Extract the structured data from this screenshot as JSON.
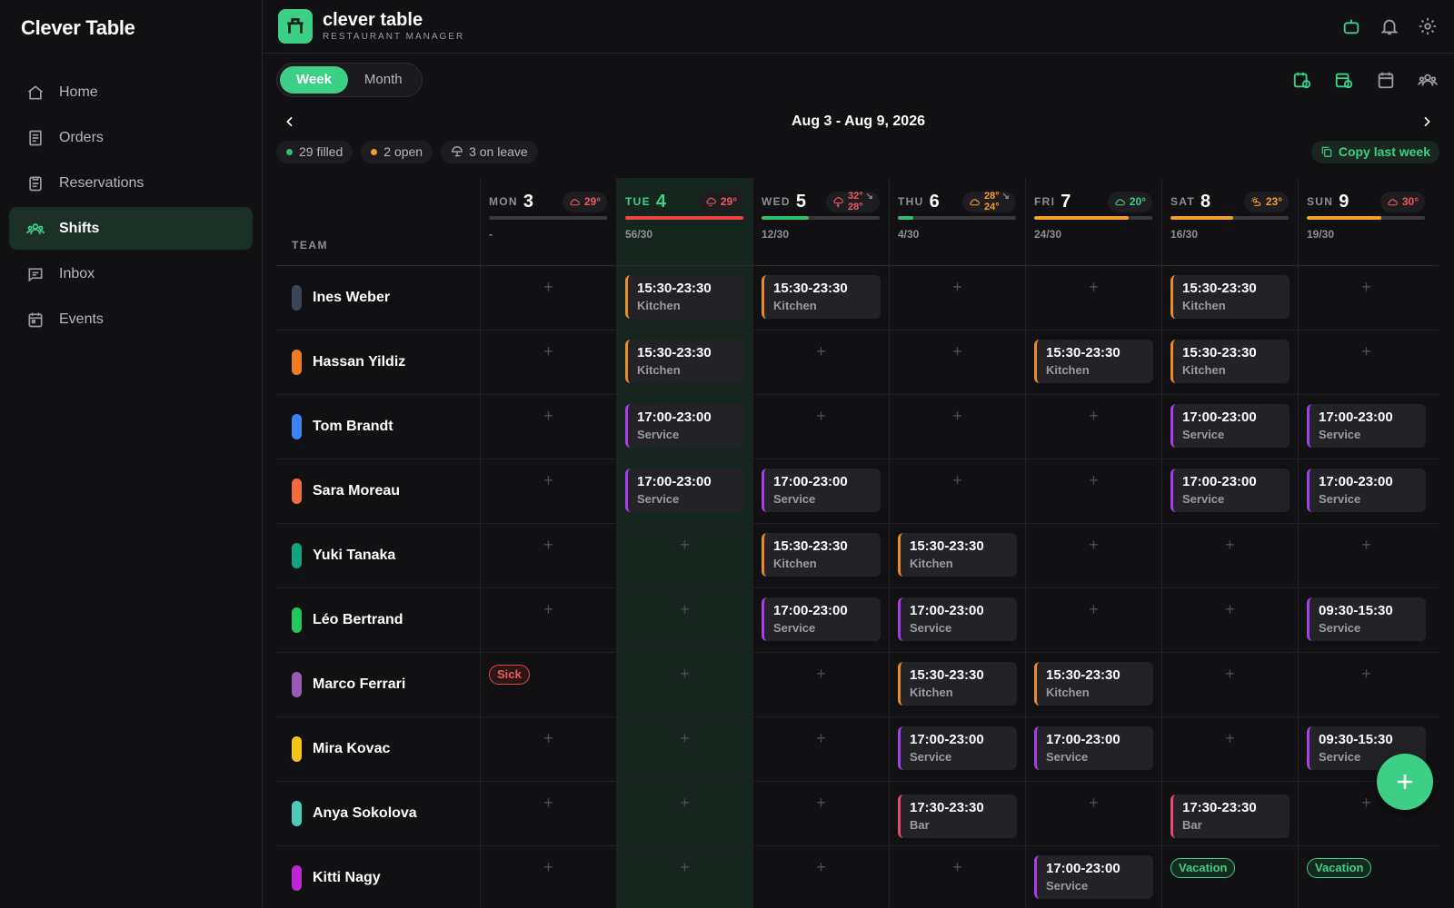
{
  "brand": "Clever Table",
  "nav": [
    {
      "label": "Home",
      "icon": "home-icon",
      "active": false
    },
    {
      "label": "Orders",
      "icon": "orders-icon",
      "active": false
    },
    {
      "label": "Reservations",
      "icon": "clipboard-icon",
      "active": false
    },
    {
      "label": "Shifts",
      "icon": "team-icon",
      "active": true
    },
    {
      "label": "Inbox",
      "icon": "inbox-icon",
      "active": false
    },
    {
      "label": "Events",
      "icon": "calendar-icon",
      "active": false
    }
  ],
  "header": {
    "app_name": "clever table",
    "app_sub": "RESTAURANT MANAGER"
  },
  "view_toggle": {
    "week": "Week",
    "month": "Month",
    "selected": "Week"
  },
  "date_range": "Aug 3 - Aug 9, 2026",
  "stats": {
    "filled": "29 filled",
    "open": "2 open",
    "leave": "3 on leave",
    "copy_label": "Copy last week"
  },
  "team_header": "TEAM",
  "days": [
    {
      "name": "MON",
      "num": "3",
      "temp": "29°",
      "temp2": "",
      "trend": "",
      "weather": "cloud",
      "wx_color": "#ef5a5a",
      "coverage": "-",
      "fill": 0,
      "bar_color": "#38383e",
      "today": false
    },
    {
      "name": "TUE",
      "num": "4",
      "temp": "29°",
      "temp2": "",
      "trend": "",
      "weather": "rain",
      "wx_color": "#ef5a5a",
      "coverage": "56/30",
      "fill": 1,
      "bar_color": "#ef4444",
      "today": true
    },
    {
      "name": "WED",
      "num": "5",
      "temp": "32°",
      "temp2": "28°",
      "trend": "↘",
      "weather": "storm",
      "wx_color": "#ef5a5a",
      "coverage": "12/30",
      "fill": 0.4,
      "bar_color": "#2fbf6e",
      "today": false
    },
    {
      "name": "THU",
      "num": "6",
      "temp": "28°",
      "temp2": "24°",
      "trend": "↘",
      "weather": "cloud",
      "wx_color": "#f59e2a",
      "coverage": "4/30",
      "fill": 0.13,
      "bar_color": "#2fbf6e",
      "today": false
    },
    {
      "name": "FRI",
      "num": "7",
      "temp": "20°",
      "temp2": "",
      "trend": "",
      "weather": "cloud",
      "wx_color": "#3ecf86",
      "coverage": "24/30",
      "fill": 0.8,
      "bar_color": "#f59e2a",
      "today": false
    },
    {
      "name": "SAT",
      "num": "8",
      "temp": "23°",
      "temp2": "",
      "trend": "",
      "weather": "sun-cloud",
      "wx_color": "#f59e2a",
      "coverage": "16/30",
      "fill": 0.53,
      "bar_color": "#f59e2a",
      "today": false
    },
    {
      "name": "SUN",
      "num": "9",
      "temp": "30°",
      "temp2": "",
      "trend": "",
      "weather": "cloud",
      "wx_color": "#ef5a5a",
      "coverage": "19/30",
      "fill": 0.63,
      "bar_color": "#f59e2a",
      "today": false
    }
  ],
  "team": [
    {
      "name": "Ines Weber",
      "color": "#3a4658",
      "cells": [
        null,
        {
          "time": "15:30-23:30",
          "role": "Kitchen"
        },
        {
          "time": "15:30-23:30",
          "role": "Kitchen"
        },
        null,
        null,
        {
          "time": "15:30-23:30",
          "role": "Kitchen"
        },
        null
      ]
    },
    {
      "name": "Hassan Yildiz",
      "color": "#f07c22",
      "cells": [
        null,
        {
          "time": "15:30-23:30",
          "role": "Kitchen"
        },
        null,
        null,
        {
          "time": "15:30-23:30",
          "role": "Kitchen"
        },
        {
          "time": "15:30-23:30",
          "role": "Kitchen"
        },
        null
      ]
    },
    {
      "name": "Tom Brandt",
      "color": "#3b82f6",
      "cells": [
        null,
        {
          "time": "17:00-23:00",
          "role": "Service"
        },
        null,
        null,
        null,
        {
          "time": "17:00-23:00",
          "role": "Service"
        },
        {
          "time": "17:00-23:00",
          "role": "Service"
        }
      ]
    },
    {
      "name": "Sara Moreau",
      "color": "#f26b3a",
      "cells": [
        null,
        {
          "time": "17:00-23:00",
          "role": "Service"
        },
        {
          "time": "17:00-23:00",
          "role": "Service"
        },
        null,
        null,
        {
          "time": "17:00-23:00",
          "role": "Service"
        },
        {
          "time": "17:00-23:00",
          "role": "Service"
        }
      ]
    },
    {
      "name": "Yuki Tanaka",
      "color": "#14a37f",
      "cells": [
        null,
        null,
        {
          "time": "15:30-23:30",
          "role": "Kitchen"
        },
        {
          "time": "15:30-23:30",
          "role": "Kitchen"
        },
        null,
        null,
        null
      ]
    },
    {
      "name": "Léo Bertrand",
      "color": "#22c55e",
      "cells": [
        null,
        null,
        {
          "time": "17:00-23:00",
          "role": "Service"
        },
        {
          "time": "17:00-23:00",
          "role": "Service"
        },
        null,
        null,
        {
          "time": "09:30-15:30",
          "role": "Service"
        }
      ]
    },
    {
      "name": "Marco Ferrari",
      "color": "#9b59b6",
      "cells": [
        {
          "tag": "Sick"
        },
        null,
        null,
        {
          "time": "15:30-23:30",
          "role": "Kitchen"
        },
        {
          "time": "15:30-23:30",
          "role": "Kitchen"
        },
        null,
        null
      ]
    },
    {
      "name": "Mira Kovac",
      "color": "#f5c518",
      "cells": [
        null,
        null,
        null,
        {
          "time": "17:00-23:00",
          "role": "Service"
        },
        {
          "time": "17:00-23:00",
          "role": "Service"
        },
        null,
        {
          "time": "09:30-15:30",
          "role": "Service"
        }
      ]
    },
    {
      "name": "Anya Sokolova",
      "color": "#4fc9b8",
      "cells": [
        null,
        null,
        null,
        {
          "time": "17:30-23:30",
          "role": "Bar"
        },
        null,
        {
          "time": "17:30-23:30",
          "role": "Bar"
        },
        null
      ]
    },
    {
      "name": "Kitti Nagy",
      "color": "#c026d3",
      "cells": [
        null,
        null,
        null,
        null,
        {
          "time": "17:00-23:00",
          "role": "Service"
        },
        {
          "tag": "Vacation"
        },
        {
          "tag": "Vacation"
        }
      ]
    }
  ],
  "colors": {
    "accent": "#3ecf86",
    "kitchen": "#e98b2b",
    "service": "#a83ee9",
    "bar": "#e94a6f",
    "sick": "#ef5a5a"
  }
}
